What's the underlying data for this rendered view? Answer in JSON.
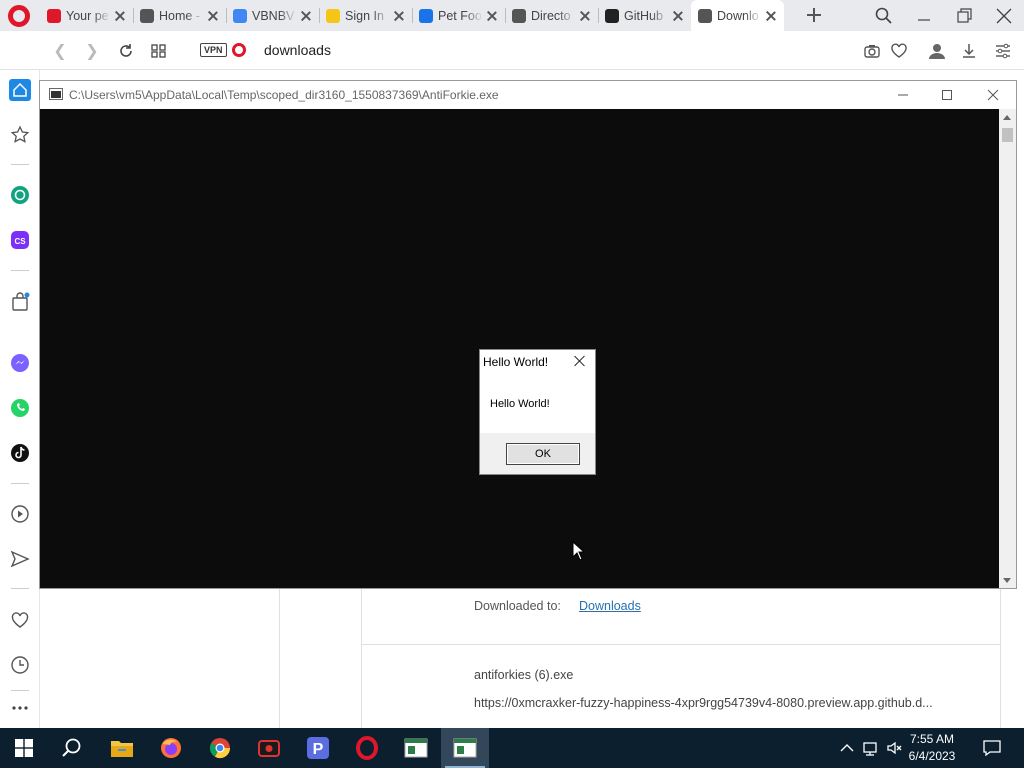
{
  "browser": {
    "tabs": [
      {
        "title": "Your pe",
        "icon": "opera-icon",
        "color": "#e0162b"
      },
      {
        "title": "Home -",
        "icon": "calendar-icon",
        "color": "#555555"
      },
      {
        "title": "VBNBV",
        "icon": "google-icon",
        "color": "#4285f4"
      },
      {
        "title": "Sign In",
        "icon": "arrow-logo-icon",
        "color": "#f5c518"
      },
      {
        "title": "Pet Foo",
        "icon": "c-logo-icon",
        "color": "#1a73e8"
      },
      {
        "title": "Directo",
        "icon": "globe-icon",
        "color": "#555555"
      },
      {
        "title": "GitHub",
        "icon": "github-icon",
        "color": "#222222"
      },
      {
        "title": "Downlo",
        "icon": "download-icon",
        "color": "#555555",
        "active": true
      }
    ],
    "address": {
      "vpn_label": "VPN",
      "url_text": "downloads"
    }
  },
  "console_window": {
    "title_path": "C:\\Users\\vm5\\AppData\\Local\\Temp\\scoped_dir3160_1550837369\\AntiForkie.exe"
  },
  "message_box": {
    "title": "Hello World!",
    "text": "Hello World!",
    "ok_label": "OK"
  },
  "downloads_page": {
    "downloaded_to_label": "Downloaded to:",
    "downloaded_to_link": "Downloads",
    "file_name": "antiforkies (6).exe",
    "file_url": "https://0xmcraxker-fuzzy-happiness-4xpr9rgg54739v4-8080.preview.app.github.d..."
  },
  "taskbar": {
    "time": "7:55 AM",
    "date": "6/4/2023"
  },
  "colors": {
    "opera_red": "#e0162b",
    "taskbar": "#0b1f2f",
    "link": "#2a6fb0"
  }
}
